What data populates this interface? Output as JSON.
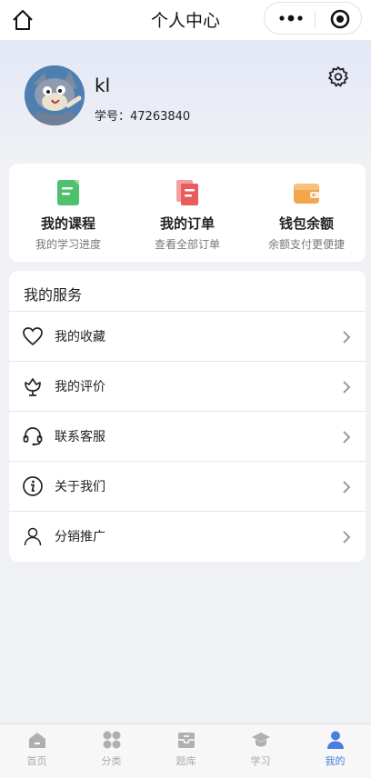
{
  "nav": {
    "title": "个人中心",
    "home_icon": "home-icon",
    "more_icon": "more-dots-icon",
    "target_icon": "target-icon"
  },
  "profile": {
    "username": "kl",
    "student_id": "学号：47263840",
    "avatar_icon": "cat-avatar",
    "settings_icon": "gear-icon"
  },
  "quick": [
    {
      "title": "我的课程",
      "subtitle": "我的学习进度",
      "icon": "book-icon",
      "color": "#4fc06d"
    },
    {
      "title": "我的订单",
      "subtitle": "查看全部订单",
      "icon": "order-icon",
      "color": "#ea5c5c"
    },
    {
      "title": "钱包余额",
      "subtitle": "余额支付更便捷",
      "icon": "wallet-icon",
      "color": "#f2a64b"
    }
  ],
  "services": {
    "title": "我的服务",
    "items": [
      {
        "label": "我的收藏",
        "icon": "heart-icon"
      },
      {
        "label": "我的评价",
        "icon": "flower-icon"
      },
      {
        "label": "联系客服",
        "icon": "headset-icon"
      },
      {
        "label": "关于我们",
        "icon": "info-icon"
      },
      {
        "label": "分销推广",
        "icon": "person-icon"
      }
    ]
  },
  "tabbar": {
    "active_color": "#4a7de0",
    "inactive_color": "#b0b0b0",
    "items": [
      {
        "label": "首页",
        "icon": "home-tab-icon"
      },
      {
        "label": "分类",
        "icon": "category-icon"
      },
      {
        "label": "题库",
        "icon": "question-bank-icon"
      },
      {
        "label": "学习",
        "icon": "study-icon"
      },
      {
        "label": "我的",
        "icon": "profile-tab-icon",
        "active": true
      }
    ]
  }
}
